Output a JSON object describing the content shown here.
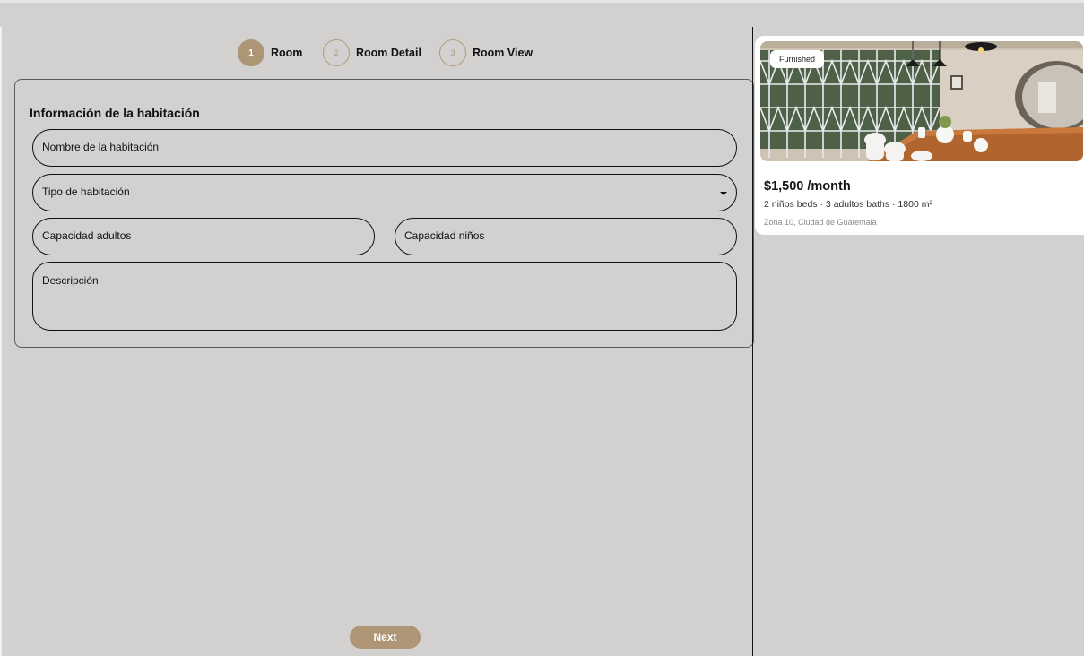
{
  "stepper": {
    "steps": [
      {
        "number": "1",
        "label": "Room",
        "state": "active"
      },
      {
        "number": "2",
        "label": "Room Detail",
        "state": "inactive"
      },
      {
        "number": "3",
        "label": "Room View",
        "state": "inactive"
      }
    ]
  },
  "form": {
    "title": "Información de la habitación",
    "room_name_placeholder": "Nombre de la habitación",
    "room_type_placeholder": "Tipo de habitación",
    "adults_capacity_placeholder": "Capacidad adultos",
    "children_capacity_placeholder": "Capacidad niños",
    "description_placeholder": "Descripción"
  },
  "actions": {
    "next_label": "Next"
  },
  "preview": {
    "badge": "Furnished",
    "price": "$1,500 /month",
    "specs": "2 niños beds · 3 adultos baths · 1800 m²",
    "location": "Zona 10, Ciudad de Guatemala",
    "image_alt": "furnished-dining-room-photo"
  },
  "colors": {
    "accent": "#ac9676",
    "background": "#d3d1cf",
    "card": "#ffffff"
  }
}
